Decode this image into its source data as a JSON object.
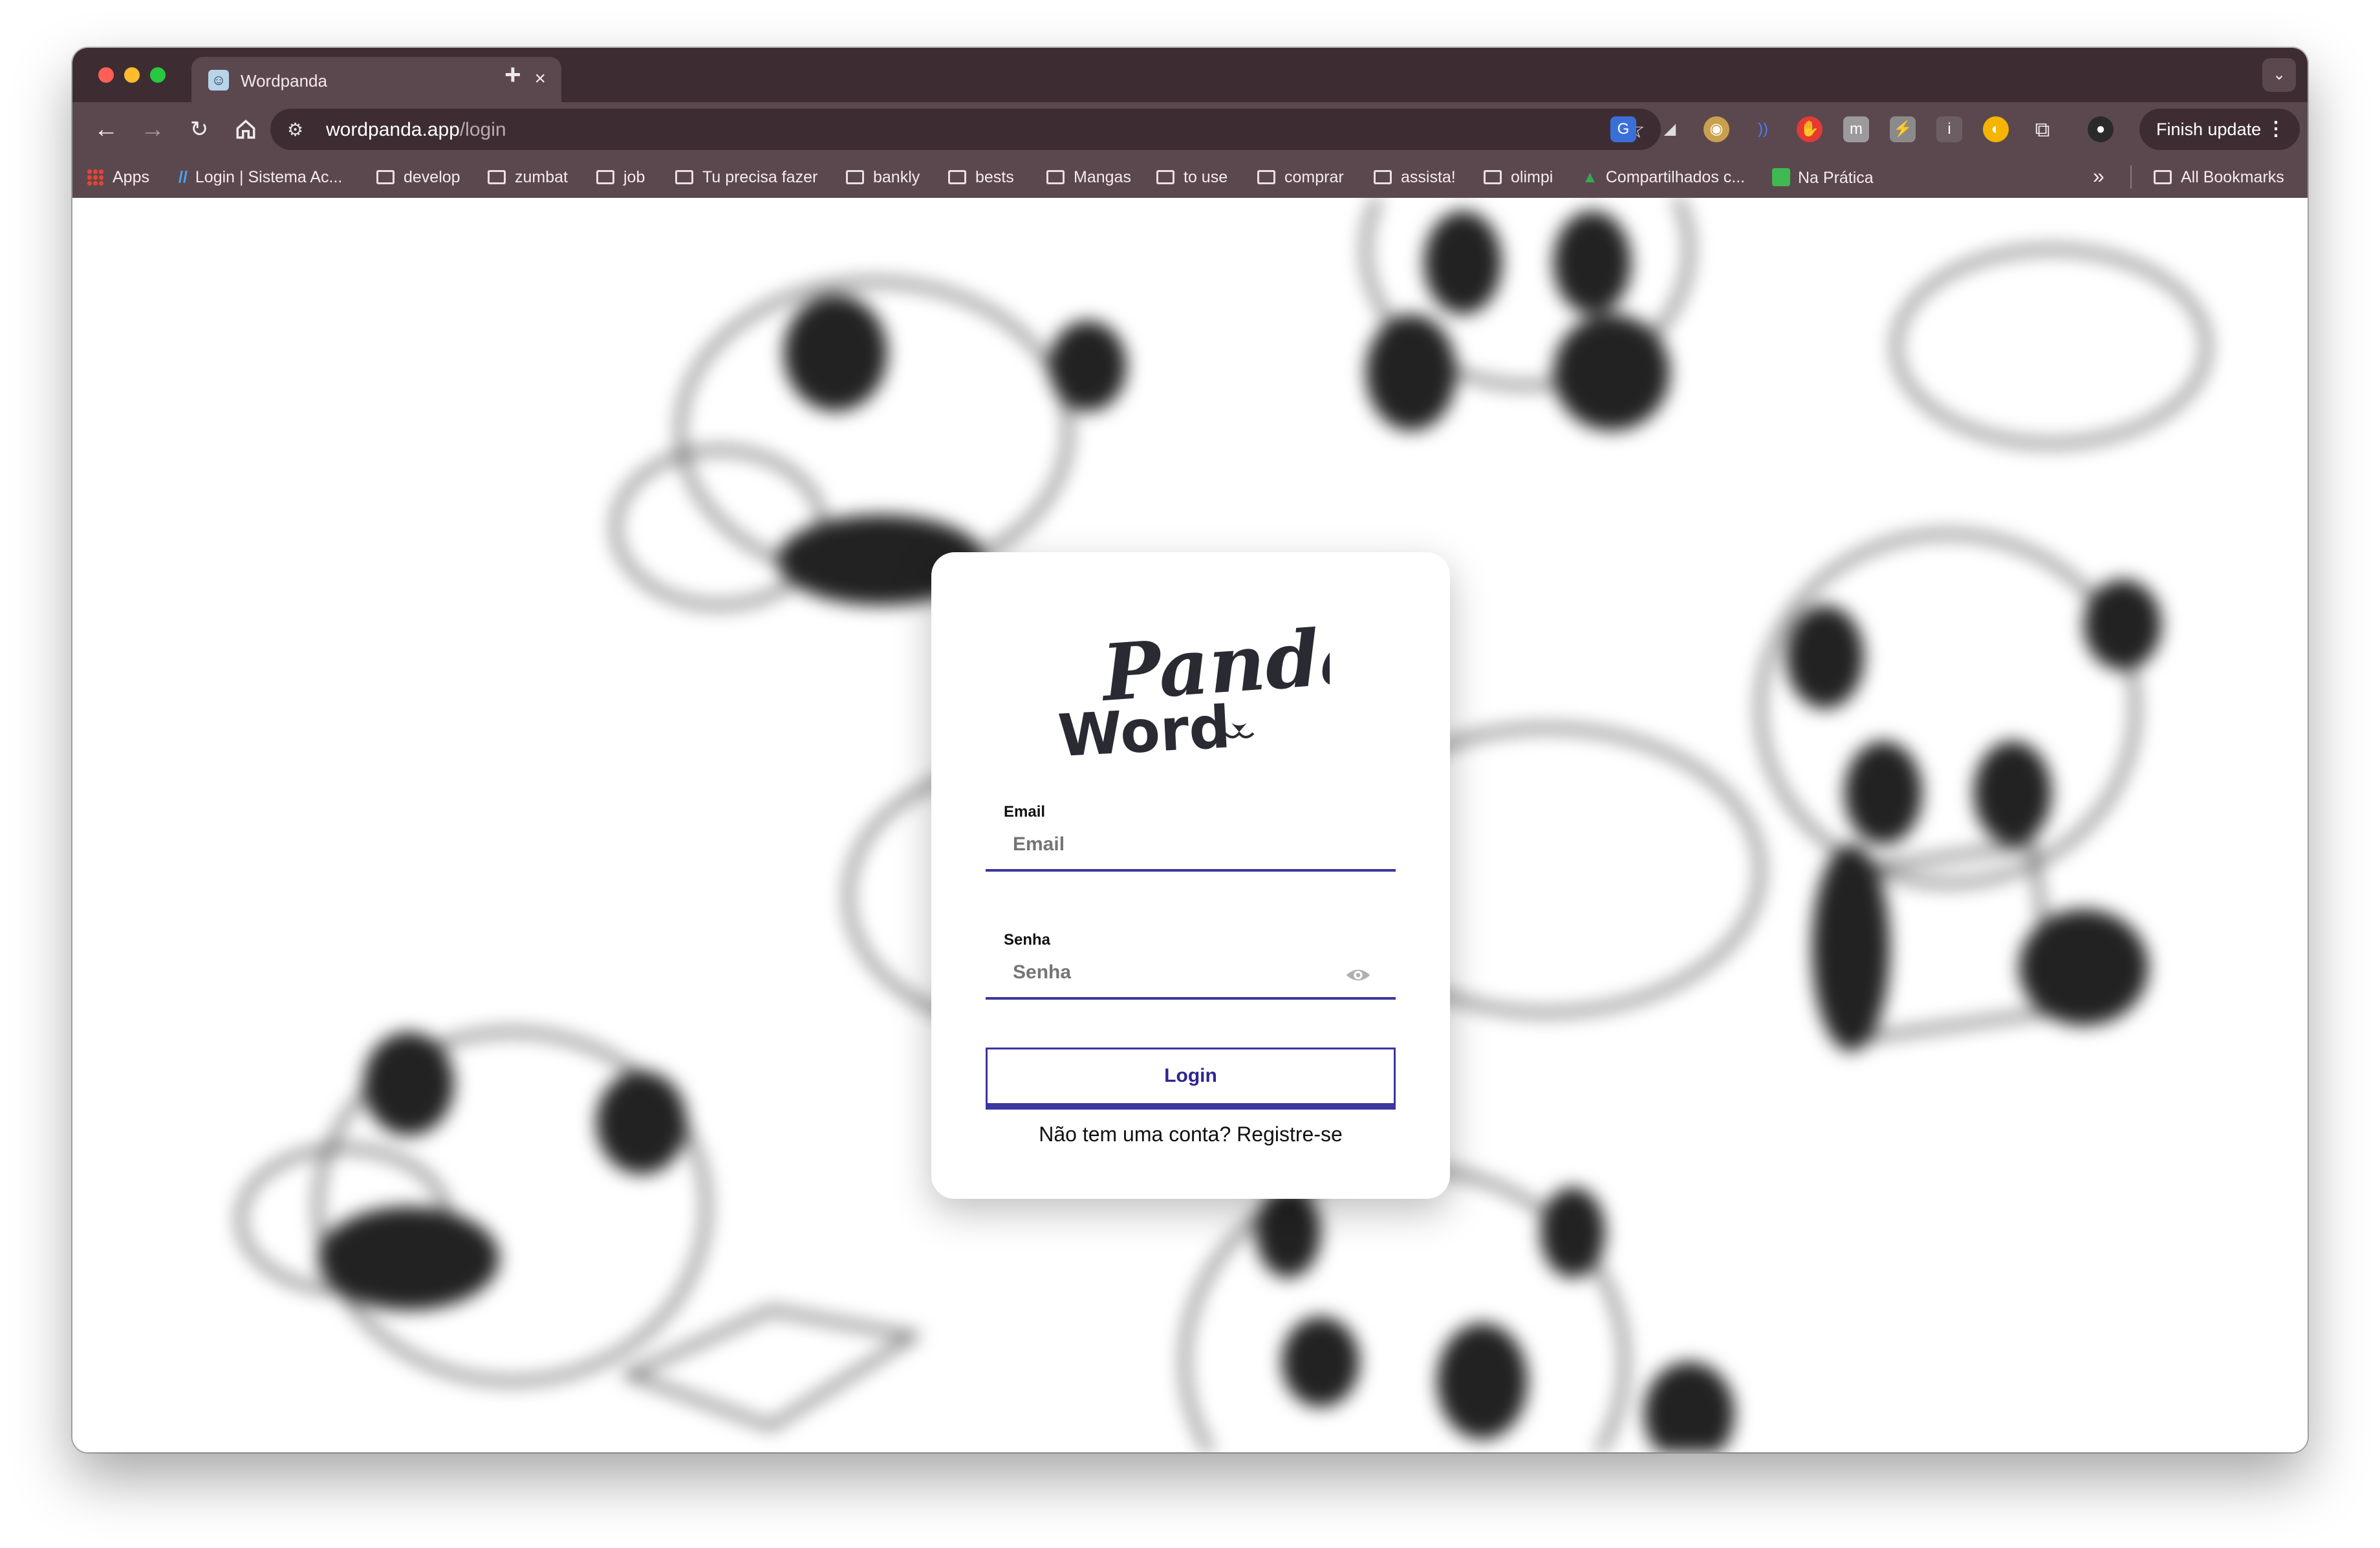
{
  "browser": {
    "tab_title": "Wordpanda",
    "tab_close": "×",
    "new_tab": "+",
    "url_host": "wordpanda.app",
    "url_path": "/login",
    "finish_update": "Finish update",
    "bookmarks": [
      {
        "label": "Apps",
        "type": "apps"
      },
      {
        "label": "Login | Sistema Ac...",
        "type": "link"
      },
      {
        "label": "develop",
        "type": "folder"
      },
      {
        "label": "zumbat",
        "type": "folder"
      },
      {
        "label": "job",
        "type": "folder"
      },
      {
        "label": "Tu precisa fazer",
        "type": "folder"
      },
      {
        "label": "bankly",
        "type": "folder"
      },
      {
        "label": "bests",
        "type": "folder"
      },
      {
        "label": "Mangas",
        "type": "folder"
      },
      {
        "label": "to use",
        "type": "folder"
      },
      {
        "label": "comprar",
        "type": "folder"
      },
      {
        "label": "assista!",
        "type": "folder"
      },
      {
        "label": "olimpi",
        "type": "folder"
      },
      {
        "label": "Compartilhados c...",
        "type": "drive"
      },
      {
        "label": "Na Prática",
        "type": "link"
      }
    ],
    "bookmarks_overflow": "»",
    "all_bookmarks": "All Bookmarks"
  },
  "login": {
    "logo_text_top": "Panda",
    "logo_text_bottom": "Word",
    "email_label": "Email",
    "email_placeholder": "Email",
    "password_label": "Senha",
    "password_placeholder": "Senha",
    "login_button": "Login",
    "register_text": "Não tem uma conta? Registre-se"
  },
  "colors": {
    "accent": "#3d35a0",
    "chrome_dark": "#3d2d33",
    "chrome": "#5b484e"
  }
}
